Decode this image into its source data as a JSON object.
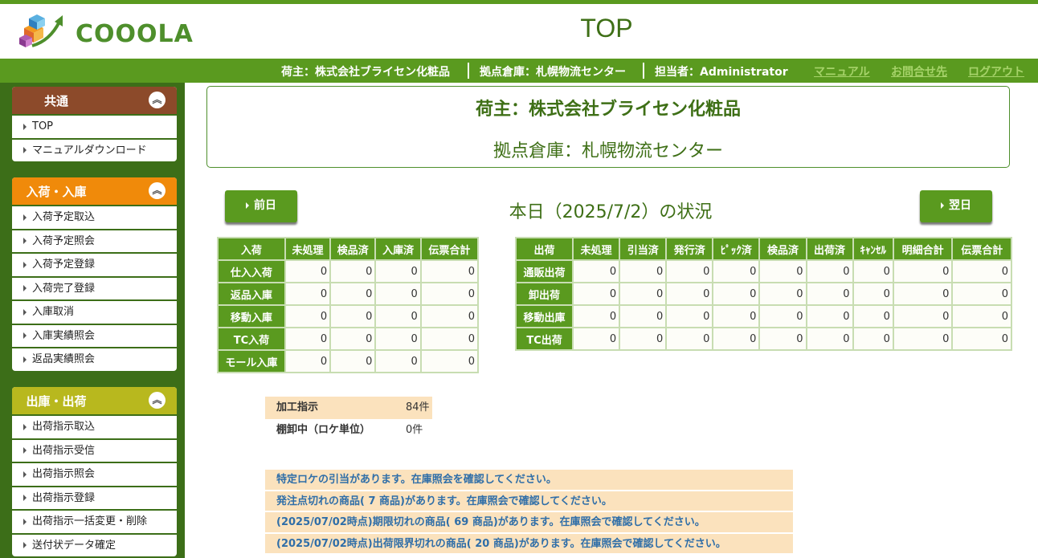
{
  "header": {
    "logo_text": "COOOLA",
    "page_title": "TOP"
  },
  "infobar": {
    "owner": "荷主：株式会社ブライセン化粧品",
    "warehouse": "拠点倉庫：札幌物流センター",
    "staff": "担当者：Administrator",
    "links": [
      "マニュアル",
      "お問合せ先",
      "ログアウト"
    ]
  },
  "sidebar": {
    "groups": [
      {
        "title": "共通",
        "color": "#8c4a2a",
        "items": [
          "TOP",
          "マニュアルダウンロード"
        ]
      },
      {
        "title": "入荷・入庫",
        "color": "#f08a0a",
        "items": [
          "入荷予定取込",
          "入荷予定照会",
          "入荷予定登録",
          "入荷完了登録",
          "入庫取消",
          "入庫実績照会",
          "返品実績照会"
        ]
      },
      {
        "title": "出庫・出荷",
        "color": "#b8b81e",
        "items": [
          "出荷指示取込",
          "出荷指示受信",
          "出荷指示照会",
          "出荷指示登録",
          "出荷指示一括変更・削除",
          "送付状データ確定"
        ]
      }
    ]
  },
  "owner_box": {
    "line1": "荷主：株式会社ブライセン化粧品",
    "line2": "拠点倉庫：札幌物流センター"
  },
  "nav": {
    "prev": "前日",
    "next": "翌日",
    "status_title": "本日（2025/7/2）の状況"
  },
  "inbound": {
    "headers": [
      "入荷",
      "未処理",
      "検品済",
      "入庫済",
      "伝票合計"
    ],
    "rows": [
      [
        "仕入入荷",
        "0",
        "0",
        "0",
        "0"
      ],
      [
        "返品入庫",
        "0",
        "0",
        "0",
        "0"
      ],
      [
        "移動入庫",
        "0",
        "0",
        "0",
        "0"
      ],
      [
        "TC入荷",
        "0",
        "0",
        "0",
        "0"
      ],
      [
        "モール入庫",
        "0",
        "0",
        "0",
        "0"
      ]
    ]
  },
  "outbound": {
    "headers": [
      "出荷",
      "未処理",
      "引当済",
      "発行済",
      "ﾋﾟｯｸ済",
      "検品済",
      "出荷済",
      "ｷｬﾝｾﾙ",
      "明細合計",
      "伝票合計"
    ],
    "rows": [
      [
        "通販出荷",
        "0",
        "0",
        "0",
        "0",
        "0",
        "0",
        "0",
        "0",
        "0"
      ],
      [
        "卸出荷",
        "0",
        "0",
        "0",
        "0",
        "0",
        "0",
        "0",
        "0",
        "0"
      ],
      [
        "移動出庫",
        "0",
        "0",
        "0",
        "0",
        "0",
        "0",
        "0",
        "0",
        "0"
      ],
      [
        "TC出荷",
        "0",
        "0",
        "0",
        "0",
        "0",
        "0",
        "0",
        "0",
        "0"
      ]
    ]
  },
  "processing": [
    {
      "label": "加工指示",
      "value": "84件"
    },
    {
      "label": "棚卸中（ロケ単位）",
      "value": "0件"
    }
  ],
  "alerts": [
    "特定ロケの引当があります。在庫照会を確認してください。",
    "発注点切れの商品( 7 商品)があります。在庫照会で確認してください。",
    "(2025/07/02時点)期限切れの商品( 69 商品)があります。在庫照会で確認してください。",
    "(2025/07/02時点)出荷限界切れの商品( 20 商品)があります。在庫照会で確認してください。"
  ]
}
